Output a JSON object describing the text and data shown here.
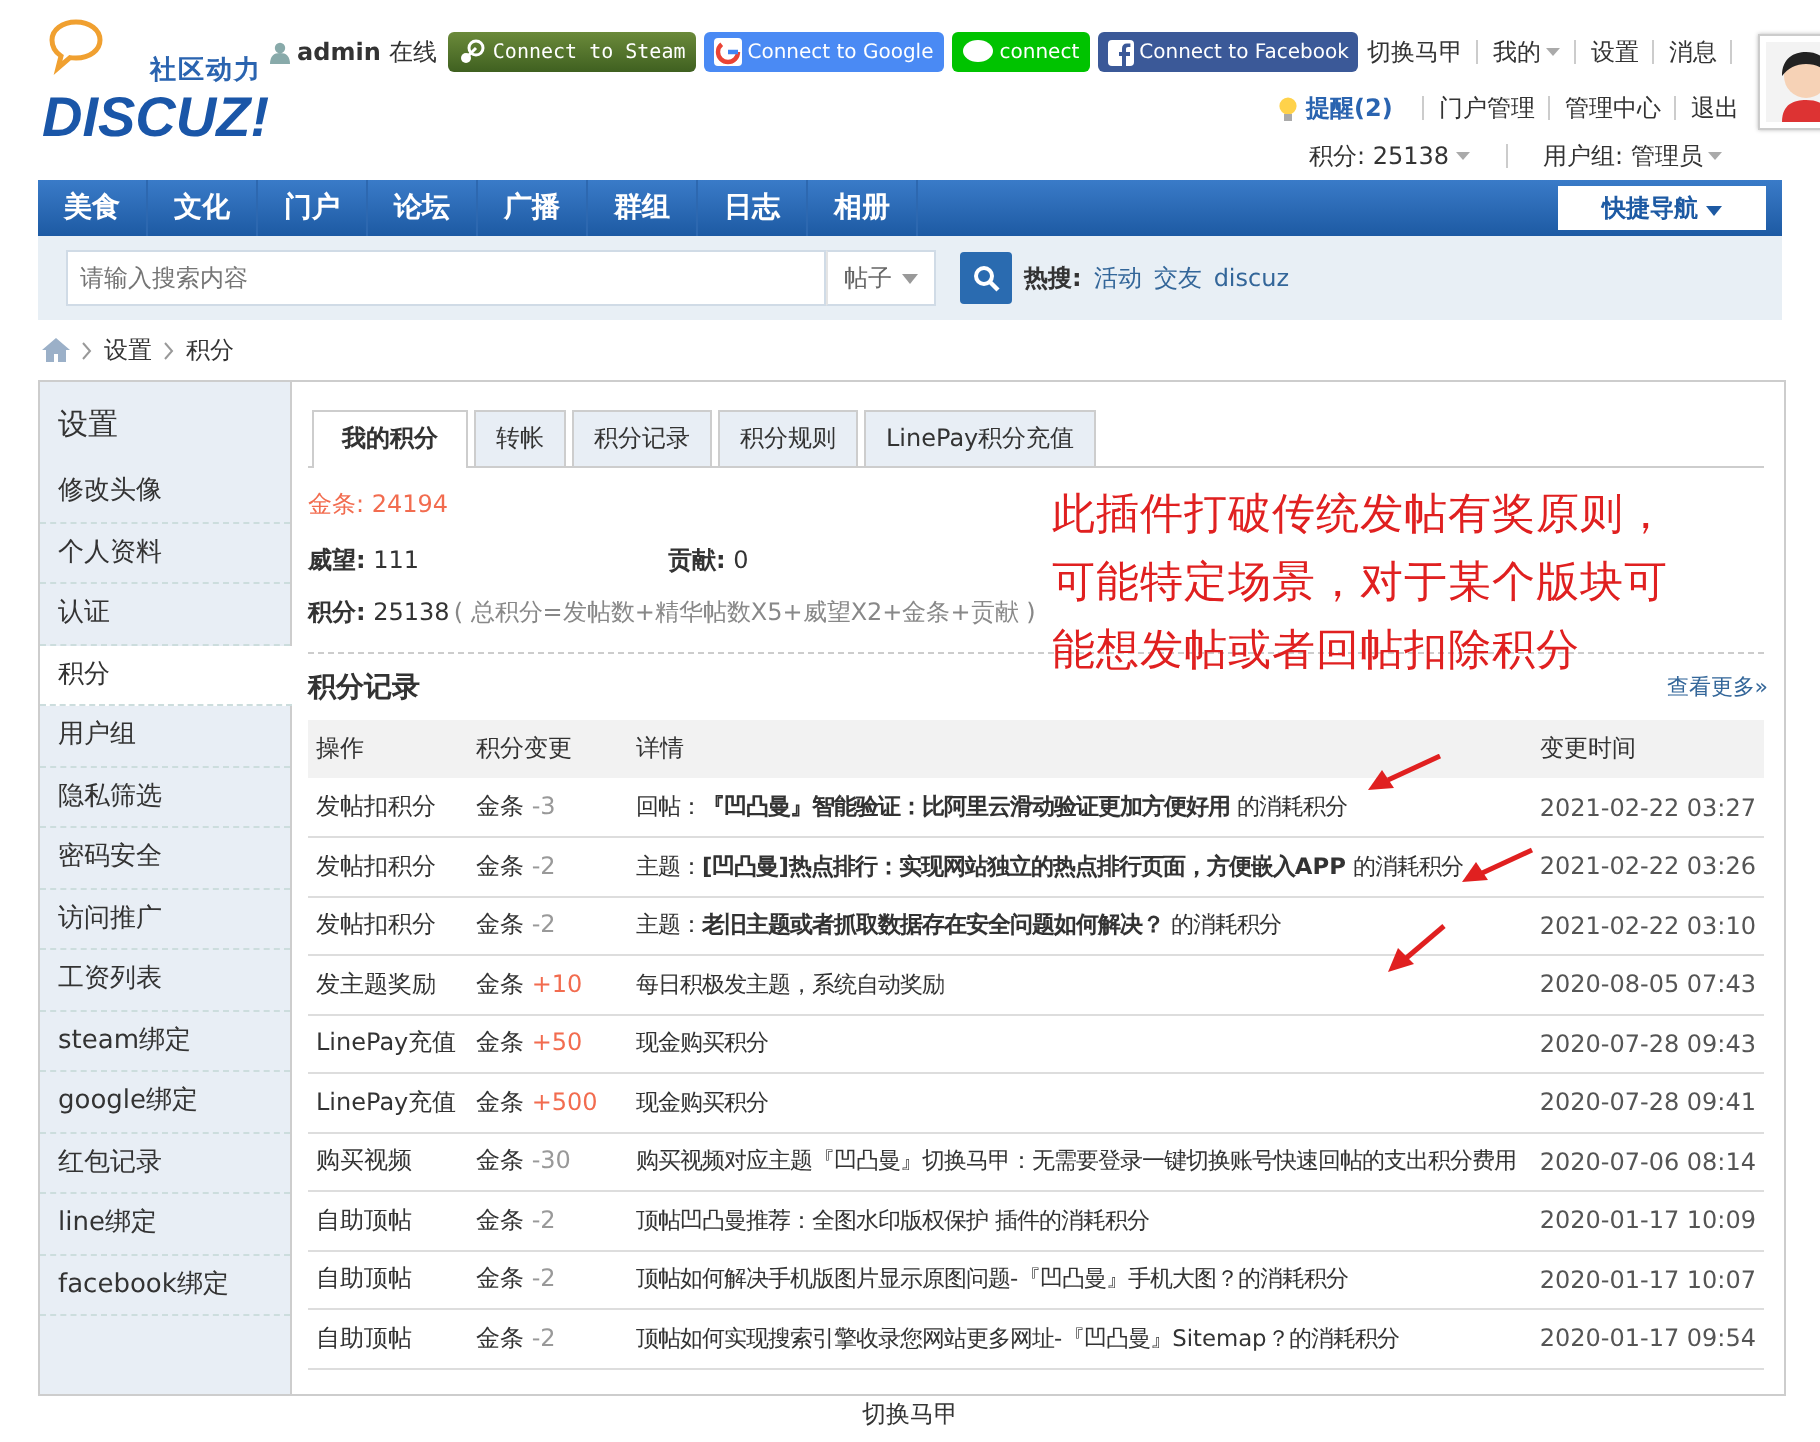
{
  "logo": {
    "tagline": "社区动力",
    "wordmark": "DISCUZ!"
  },
  "user": {
    "name": "admin",
    "status": "在线"
  },
  "connect_buttons": [
    {
      "kind": "steam",
      "label": "Connect to Steam"
    },
    {
      "kind": "google",
      "label": "Connect to Google"
    },
    {
      "kind": "line",
      "label": "connect"
    },
    {
      "kind": "facebook",
      "label": "Connect to Facebook"
    }
  ],
  "top_links": [
    {
      "label": "切换马甲",
      "dropdown": false
    },
    {
      "label": "我的",
      "dropdown": true
    },
    {
      "label": "设置",
      "dropdown": false
    },
    {
      "label": "消息",
      "dropdown": false
    }
  ],
  "notice": {
    "label": "提醒(2)"
  },
  "admin_links": [
    "门户管理",
    "管理中心",
    "退出"
  ],
  "stats_links": [
    {
      "label": "积分: 25138",
      "dropdown": true
    },
    {
      "label": "用户组: 管理员",
      "dropdown": true
    }
  ],
  "nav": {
    "items": [
      "美食",
      "文化",
      "门户",
      "论坛",
      "广播",
      "群组",
      "日志",
      "相册"
    ],
    "quick": "快捷导航"
  },
  "search": {
    "placeholder": "请输入搜索内容",
    "type": "帖子",
    "hot_label": "热搜:",
    "hot": [
      "活动",
      "交友",
      "discuz"
    ]
  },
  "breadcrumb": [
    "设置",
    "积分"
  ],
  "sidebar": {
    "title": "设置",
    "items": [
      {
        "label": "修改头像",
        "selected": false
      },
      {
        "label": "个人资料",
        "selected": false
      },
      {
        "label": "认证",
        "selected": false
      },
      {
        "label": "积分",
        "selected": true
      },
      {
        "label": "用户组",
        "selected": false
      },
      {
        "label": "隐私筛选",
        "selected": false
      },
      {
        "label": "密码安全",
        "selected": false
      },
      {
        "label": "访问推广",
        "selected": false
      },
      {
        "label": "工资列表",
        "selected": false
      },
      {
        "label": "steam绑定",
        "selected": false
      },
      {
        "label": "google绑定",
        "selected": false
      },
      {
        "label": "红包记录",
        "selected": false
      },
      {
        "label": "line绑定",
        "selected": false
      },
      {
        "label": "facebook绑定",
        "selected": false
      }
    ]
  },
  "tabs": [
    {
      "label": "我的积分",
      "selected": true
    },
    {
      "label": "转帐",
      "selected": false
    },
    {
      "label": "积分记录",
      "selected": false
    },
    {
      "label": "积分规则",
      "selected": false
    },
    {
      "label": "LinePay积分充值",
      "selected": false
    }
  ],
  "credits": {
    "gold": {
      "label": "金条:",
      "value": "24194"
    },
    "prestige": {
      "label": "威望:",
      "value": "111"
    },
    "contribution": {
      "label": "贡献:",
      "value": "0"
    },
    "total": {
      "label": "积分:",
      "value": "25138",
      "formula": "( 总积分=发帖数+精华帖数X5+威望X2+金条+贡献 )"
    }
  },
  "annotation": {
    "lines": [
      "此插件打破传统发帖有奖原则，",
      "可能特定场景，对于某个版块可",
      "能想发帖或者回帖扣除积分"
    ]
  },
  "log": {
    "title": "积分记录",
    "more": "查看更多»",
    "columns": [
      "操作",
      "积分变更",
      "详情",
      "变更时间"
    ],
    "rows": [
      {
        "action": "发帖扣积分",
        "currency": "金条",
        "amount": "-3",
        "kind": "loss",
        "detail": "回帖：**『凹凸曼』智能验证：比阿里云滑动验证更加方便好用** 的消耗积分",
        "time": "2021-02-22 03:27"
      },
      {
        "action": "发帖扣积分",
        "currency": "金条",
        "amount": "-2",
        "kind": "loss",
        "detail": "主题：**[凹凸曼]热点排行：实现网站独立的热点排行页面，方便嵌入APP** 的消耗积分",
        "time": "2021-02-22 03:26"
      },
      {
        "action": "发帖扣积分",
        "currency": "金条",
        "amount": "-2",
        "kind": "loss",
        "detail": "主题：**老旧主题或者抓取数据存在安全问题如何解决？** 的消耗积分",
        "time": "2021-02-22 03:10"
      },
      {
        "action": "发主题奖励",
        "currency": "金条",
        "amount": "+10",
        "kind": "gain",
        "detail": "每日积极发主题，系统自动奖励",
        "time": "2020-08-05 07:43"
      },
      {
        "action": "LinePay充值",
        "currency": "金条",
        "amount": "+50",
        "kind": "gain",
        "detail": "现金购买积分",
        "time": "2020-07-28 09:43"
      },
      {
        "action": "LinePay充值",
        "currency": "金条",
        "amount": "+500",
        "kind": "gain",
        "detail": "现金购买积分",
        "time": "2020-07-28 09:41"
      },
      {
        "action": "购买视频",
        "currency": "金条",
        "amount": "-30",
        "kind": "loss",
        "detail": "购买视频对应主题『凹凸曼』切换马甲：无需要登录一键切换账号快速回帖的支出积分费用",
        "time": "2020-07-06 08:14"
      },
      {
        "action": "自助顶帖",
        "currency": "金条",
        "amount": "-2",
        "kind": "loss",
        "detail": "顶帖凹凸曼推荐：全图水印版权保护 插件的消耗积分",
        "time": "2020-01-17 10:09"
      },
      {
        "action": "自助顶帖",
        "currency": "金条",
        "amount": "-2",
        "kind": "loss",
        "detail": "顶帖如何解决手机版图片显示原图问题-『凹凸曼』手机大图？的消耗积分",
        "time": "2020-01-17 10:07"
      },
      {
        "action": "自助顶帖",
        "currency": "金条",
        "amount": "-2",
        "kind": "loss",
        "detail": "顶帖如何实现搜索引擎收录您网站更多网址-『凹凸曼』Sitemap？的消耗积分",
        "time": "2020-01-17 09:54"
      }
    ]
  },
  "footer": {
    "text": "切换马甲"
  }
}
